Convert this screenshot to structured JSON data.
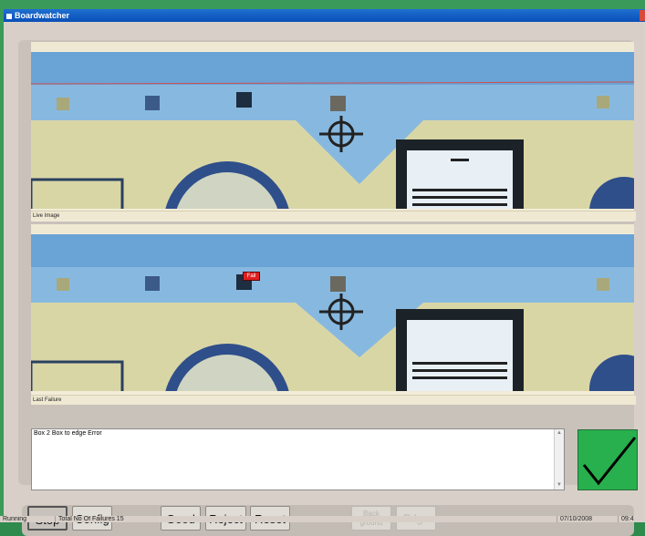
{
  "window": {
    "title": "Boardwatcher"
  },
  "panels": {
    "live_caption": "Live Image",
    "failure_caption": "Last Failure",
    "failure_marker_text": "Fail"
  },
  "log": {
    "text": "Box 2 Box to edge Error"
  },
  "status": {
    "indicator": "checkmark-icon",
    "color": "#27b04d"
  },
  "toolbar": {
    "stop": "Stop",
    "config": "Config",
    "good": "Good",
    "reject": "Reject",
    "reset": "Reset",
    "background": "Back ground",
    "edge": "Edge"
  },
  "statusbar": {
    "state": "Running",
    "failures": "Total No Of Failures 15",
    "date": "07/10/2008",
    "time": "09:4"
  }
}
